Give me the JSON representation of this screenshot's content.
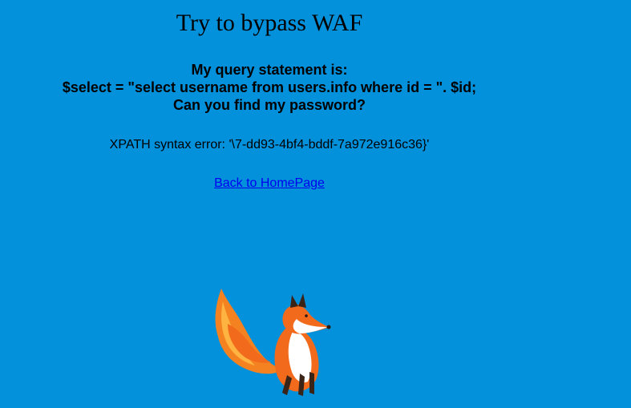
{
  "page": {
    "title": "Try to bypass WAF",
    "query_heading": "My query statement is:",
    "query_statement": "$select = \"select username from users.info where id = \". $id;",
    "query_question": "Can you find my password?",
    "error_message": "XPATH syntax error: '\\7-dd93-4bf4-bddf-7a972e916c36}'",
    "back_link": "Back to HomePage"
  },
  "images": {
    "fox": "fox-illustration"
  },
  "colors": {
    "background": "#0391dc",
    "link": "#0000ee",
    "fox_orange": "#f26a1b",
    "fox_light": "#ffa133"
  }
}
